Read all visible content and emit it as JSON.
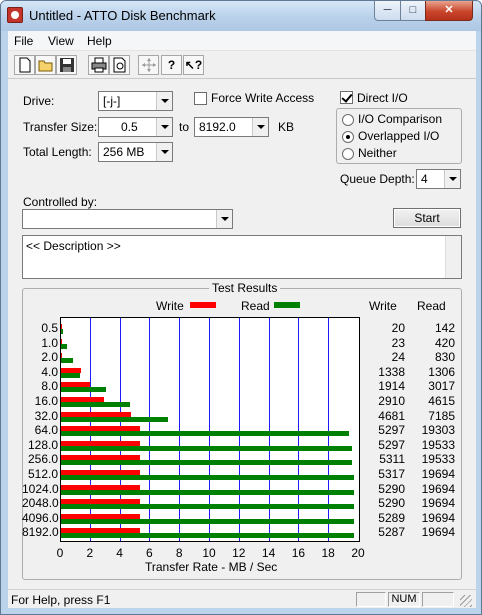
{
  "window": {
    "title": "Untitled - ATTO Disk Benchmark"
  },
  "menu": {
    "items": [
      "File",
      "View",
      "Help"
    ]
  },
  "toolbar": {
    "icons": [
      "new-icon",
      "open-icon",
      "save-icon",
      "print-icon",
      "print-preview-icon",
      "move-icon",
      "help-icon",
      "context-help-icon"
    ]
  },
  "settings": {
    "drive_label": "Drive:",
    "drive_value": "[-j-]",
    "force_write_label": "Force Write Access",
    "force_write_checked": false,
    "direct_io_label": "Direct I/O",
    "direct_io_checked": true,
    "transfer_size_label": "Transfer Size:",
    "transfer_from": "0.5",
    "to_label": "to",
    "transfer_to": "8192.0",
    "kb_label": "KB",
    "total_length_label": "Total Length:",
    "total_length_value": "256 MB",
    "io_options": [
      {
        "label": "I/O Comparison",
        "selected": false
      },
      {
        "label": "Overlapped I/O",
        "selected": true
      },
      {
        "label": "Neither",
        "selected": false
      }
    ],
    "queue_depth_label": "Queue Depth:",
    "queue_depth_value": "4",
    "controlled_by_label": "Controlled by:",
    "controlled_by_value": "",
    "start_label": "Start",
    "description": "<< Description >>"
  },
  "results": {
    "title": "Test Results",
    "legend_write": "Write",
    "legend_read": "Read",
    "col_write": "Write",
    "col_read": "Read",
    "xlabel": "Transfer Rate - MB / Sec",
    "colors": {
      "write": "#ff0000",
      "read": "#008000",
      "grid": "#1c1cff"
    }
  },
  "chart_data": {
    "type": "bar",
    "orientation": "horizontal",
    "categories": [
      "0.5",
      "1.0",
      "2.0",
      "4.0",
      "8.0",
      "16.0",
      "32.0",
      "64.0",
      "128.0",
      "256.0",
      "512.0",
      "1024.0",
      "2048.0",
      "4096.0",
      "8192.0"
    ],
    "series": [
      {
        "name": "Write",
        "values": [
          0.02,
          0.023,
          0.024,
          1.338,
          1.914,
          2.91,
          4.681,
          5.297,
          5.297,
          5.311,
          5.317,
          5.29,
          5.29,
          5.289,
          5.287
        ]
      },
      {
        "name": "Read",
        "values": [
          0.142,
          0.42,
          0.83,
          1.306,
          3.017,
          4.615,
          7.185,
          19.303,
          19.533,
          19.533,
          19.694,
          19.694,
          19.694,
          19.694,
          19.694
        ]
      }
    ],
    "write_text": [
      "20",
      "23",
      "24",
      "1338",
      "1914",
      "2910",
      "4681",
      "5297",
      "5297",
      "5311",
      "5317",
      "5290",
      "5290",
      "5289",
      "5287"
    ],
    "read_text": [
      "142",
      "420",
      "830",
      "1306",
      "3017",
      "4615",
      "7185",
      "19303",
      "19533",
      "19533",
      "19694",
      "19694",
      "19694",
      "19694",
      "19694"
    ],
    "xlim": [
      0,
      20
    ],
    "xticks": [
      "0",
      "2",
      "4",
      "6",
      "8",
      "10",
      "12",
      "14",
      "16",
      "18",
      "20"
    ],
    "xlabel": "Transfer Rate - MB / Sec"
  },
  "status": {
    "text": "For Help, press F1",
    "num": "NUM"
  }
}
